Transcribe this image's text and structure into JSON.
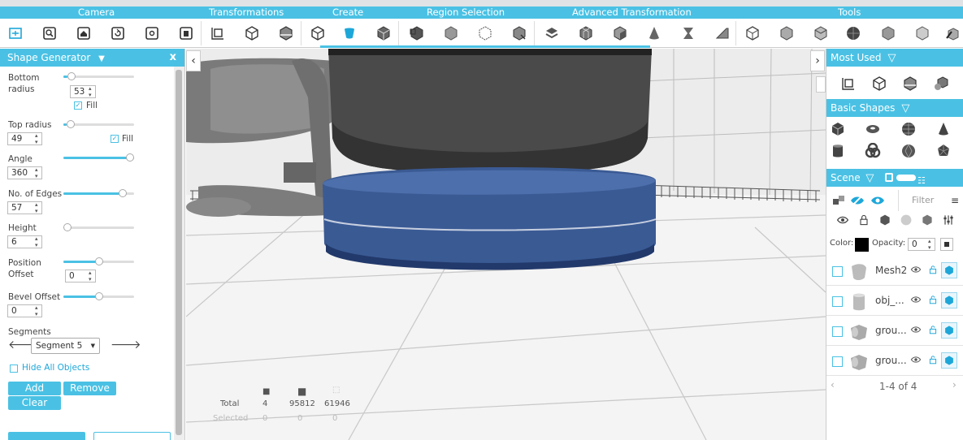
{
  "menu": {
    "categories": [
      "Camera",
      "Transformations",
      "Create",
      "Region Selection",
      "Advanced Transformation",
      "Tools"
    ]
  },
  "toolbar_icons": [
    "fit-view",
    "zoom-region",
    "home-view",
    "rotate-view",
    "settings-view",
    "export-view",
    "transform-frame",
    "cube-outline",
    "cube-cut",
    "cube-split",
    "shape-generator",
    "cube-stack",
    "cube-import",
    "cube-solid",
    "cube-wire",
    "cube-select",
    "cube-layers",
    "cube-grid",
    "cube-face",
    "cone",
    "hourglass",
    "wedge",
    "cube-box",
    "cube-bevel",
    "cube-scale",
    "sphere-dark",
    "cube-smooth",
    "cube-round",
    "cube-brush"
  ],
  "shape_generator": {
    "title": "Shape Generator",
    "close": "x",
    "bottom_radius_label": "Bottom radius",
    "bottom_radius_value": "53",
    "bottom_radius_level": 0.06,
    "fill_label": "Fill",
    "top_radius_label": "Top radius",
    "top_radius_value": "49",
    "top_radius_level": 0.05,
    "top_fill_label": "Fill",
    "angle_label": "Angle",
    "angle_value": "360",
    "angle_level": 1.0,
    "edges_label": "No. of Edges",
    "edges_value": "57",
    "edges_level": 0.88,
    "height_label": "Height",
    "height_value": "6",
    "height_level": 0.0,
    "position_offset_label": "Position Offset",
    "position_offset_value": "0",
    "position_offset_level": 0.5,
    "bevel_offset_label": "Bevel Offset",
    "bevel_offset_value": "0",
    "bevel_offset_level": 0.5,
    "segments_label": "Segments",
    "segment_value": "Segment 5",
    "hide_all_label": "Hide All Objects",
    "add_label": "Add",
    "remove_label": "Remove",
    "clear_label": "Clear"
  },
  "viewport": {
    "stats": {
      "total_label": "Total",
      "selected_label": "Selected",
      "total": [
        "4",
        "95812",
        "61946"
      ],
      "selected": [
        "0",
        "0",
        "0"
      ]
    }
  },
  "right_panel": {
    "most_used_title": "Most Used",
    "basic_shapes_title": "Basic Shapes",
    "scene_title": "Scene",
    "filter_placeholder": "Filter",
    "color_label": "Color:",
    "opacity_label": "Opacity:",
    "opacity_value": "0",
    "objects": [
      {
        "name": "Mesh2"
      },
      {
        "name": "obj_..."
      },
      {
        "name": "grou..."
      },
      {
        "name": "grou..."
      }
    ],
    "pagination": "1-4 of 4"
  },
  "colors": {
    "accent": "#4ac1e4",
    "shape": "#3a5a94"
  }
}
